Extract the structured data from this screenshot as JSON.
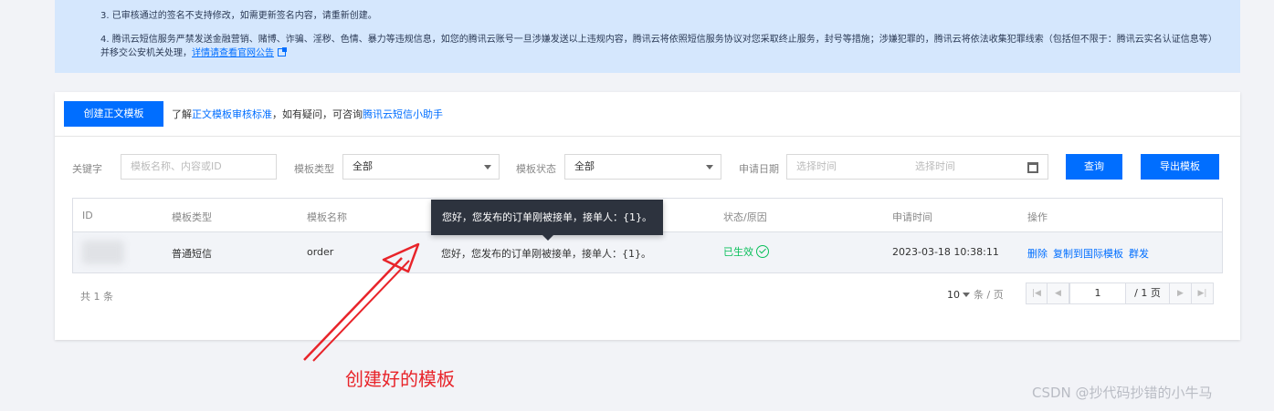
{
  "notice": {
    "item3": "3. 已审核通过的签名不支持修改，如需更新签名内容，请重新创建。",
    "item4": "4. 腾讯云短信服务严禁发送金融营销、赌博、诈骗、淫秽、色情、暴力等违规信息，如您的腾讯云账号一旦涉嫌发送以上违规内容，腾讯云将依照短信服务协议对您采取终止服务，封号等措施；涉嫌犯罪的，腾讯云将依法收集犯罪线索（包括但不限于：腾讯云实名认证信息等）并移交公安机关处理，",
    "link": "详情请查看官网公告"
  },
  "toolbar": {
    "create_button": "创建正文模板",
    "desc_prefix": "了解",
    "desc_link1": "正文模板审核标准",
    "desc_middle": "，如有疑问，可咨询",
    "desc_link2": "腾讯云短信小助手"
  },
  "filters": {
    "keyword_label": "关键字",
    "keyword_placeholder": "模板名称、内容或ID",
    "type_label": "模板类型",
    "type_value": "全部",
    "status_label": "模板状态",
    "status_value": "全部",
    "date_label": "申请日期",
    "date_start_placeholder": "选择时间",
    "date_end_placeholder": "选择时间",
    "query_button": "查询",
    "export_button": "导出模板"
  },
  "table": {
    "headers": [
      "ID",
      "模板类型",
      "模板名称",
      "状态/原因",
      "申请时间",
      "操作"
    ],
    "rows": [
      {
        "type": "普通短信",
        "name": "order",
        "content": "您好，您发布的订单刚被接单，接单人：{1}。",
        "status": "已生效",
        "time": "2023-03-18 10:38:11",
        "actions": [
          "删除",
          "复制到国际模板",
          "群发"
        ]
      }
    ]
  },
  "pagination": {
    "total": "共 1 条",
    "page_size": "10",
    "page_size_unit": "条 / 页",
    "current_page": "1",
    "total_pages": "/ 1 页"
  },
  "tooltip": {
    "text": "您好，您发布的订单刚被接单，接单人：{1}。"
  },
  "annotation": {
    "text": "创建好的模板",
    "color": "#e8242a"
  },
  "watermark": "CSDN @抄代码抄错的小牛马",
  "colors": {
    "primary": "#006eff",
    "success": "#0abf5b",
    "notice_bg": "#d5e7fd"
  }
}
